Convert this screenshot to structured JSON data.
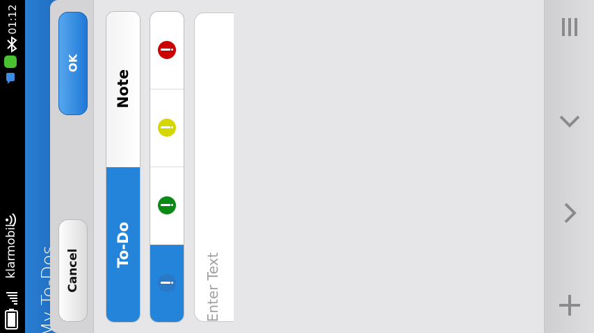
{
  "status_bar": {
    "time": "01:12",
    "carrier": "klarmobil",
    "icons": [
      "bluetooth-icon",
      "app-notify-icon",
      "chat-icon",
      "wifi-icon",
      "signal-icon",
      "battery-icon"
    ]
  },
  "app": {
    "title": "My To-Dos"
  },
  "dialog": {
    "ok_label": "OK",
    "cancel_label": "Cancel",
    "type_options": [
      {
        "label": "Note",
        "selected": false
      },
      {
        "label": "To-Do",
        "selected": true
      }
    ],
    "priority_options": [
      {
        "name": "high",
        "color": "#cc0000",
        "selected": false
      },
      {
        "name": "medium",
        "color": "#d6d600",
        "selected": false
      },
      {
        "name": "low",
        "color": "#0a8a14",
        "selected": false
      },
      {
        "name": "none",
        "color": "#2a78c8",
        "selected": true
      }
    ],
    "text_field": {
      "value": "",
      "placeholder": "Enter Text"
    }
  },
  "toolbar": {
    "items": [
      "menu-icon",
      "down-arrow-icon",
      "forward-arrow-icon",
      "add-icon"
    ]
  },
  "colors": {
    "accent": "#2384da",
    "background": "#e4e4e6"
  }
}
